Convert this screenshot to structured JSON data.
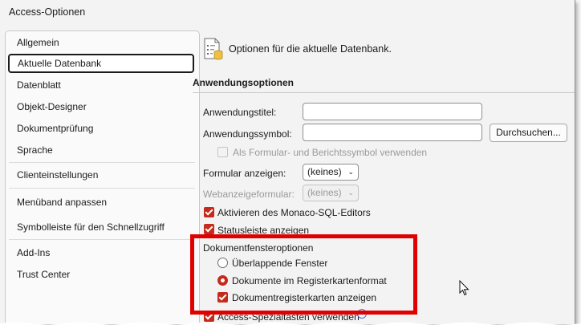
{
  "window": {
    "title": "Access-Optionen"
  },
  "nav": {
    "items": [
      {
        "label": "Allgemein"
      },
      {
        "label": "Aktuelle Datenbank"
      },
      {
        "label": "Datenblatt"
      },
      {
        "label": "Objekt-Designer"
      },
      {
        "label": "Dokumentprüfung"
      },
      {
        "label": "Sprache"
      },
      {
        "label": "Clienteinstellungen"
      },
      {
        "label": "Menüband anpassen"
      },
      {
        "label": "Symbolleiste für den Schnellzugriff"
      },
      {
        "label": "Add-Ins"
      },
      {
        "label": "Trust Center"
      }
    ],
    "selected": "Aktuelle Datenbank"
  },
  "header": {
    "text": "Optionen für die aktuelle Datenbank."
  },
  "section": {
    "title": "Anwendungsoptionen"
  },
  "app_options": {
    "app_title_label": "Anwendungstitel:",
    "app_title_value": "",
    "app_icon_label": "Anwendungssymbol:",
    "app_icon_value": "",
    "browse_label": "Durchsuchen...",
    "use_as_form_icon_label": "Als Formular- und Berichtssymbol verwenden",
    "display_form_label": "Formular anzeigen:",
    "display_form_value": "(keines)",
    "web_form_label": "Webanzeigeformular:",
    "web_form_value": "(keines)",
    "monaco_label": "Aktivieren des Monaco-SQL-Editors",
    "statusbar_label": "Statusleiste anzeigen"
  },
  "document_window": {
    "title": "Dokumentfensteroptionen",
    "overlapping_label": "Überlappende Fenster",
    "tabbed_label": "Dokumente im Registerkartenformat",
    "tabs_label": "Dokumentregisterkarten anzeigen",
    "selected_mode": "tabbed",
    "show_tabs": true
  },
  "partial": {
    "special_keys_label": "Access-Spezialtasten verwenden"
  },
  "colors": {
    "accent": "#c42b1c",
    "highlight": "#e00000"
  }
}
